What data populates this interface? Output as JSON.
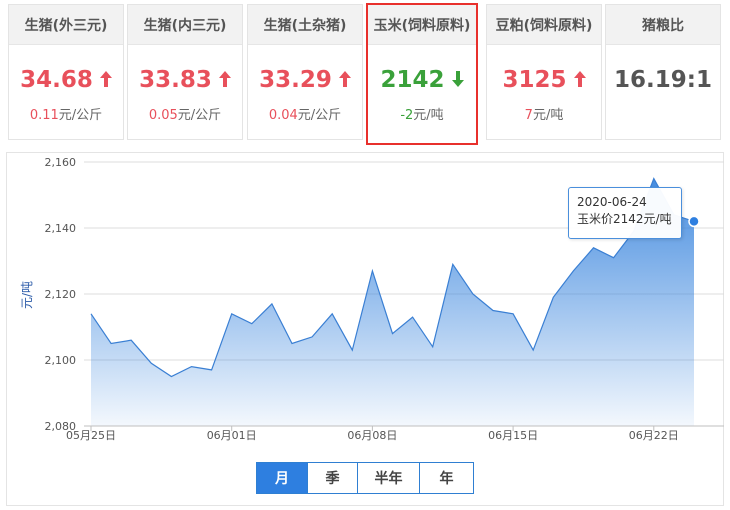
{
  "cards": [
    {
      "title": "生猪(外三元)",
      "value": "34.68",
      "direction": "up",
      "change_num": "0.11",
      "change_unit": "元/公斤"
    },
    {
      "title": "生猪(内三元)",
      "value": "33.83",
      "direction": "up",
      "change_num": "0.05",
      "change_unit": "元/公斤"
    },
    {
      "title": "生猪(土杂猪)",
      "value": "33.29",
      "direction": "up",
      "change_num": "0.04",
      "change_unit": "元/公斤"
    },
    {
      "title": "玉米(饲料原料)",
      "value": "2142",
      "direction": "down",
      "change_num": "-2",
      "change_unit": "元/吨",
      "selected": true
    },
    {
      "title": "豆粕(饲料原料)",
      "value": "3125",
      "direction": "up",
      "change_num": "7",
      "change_unit": "元/吨"
    },
    {
      "title": "猪粮比",
      "value": "16.19:1",
      "direction": "none",
      "change_num": "",
      "change_unit": ""
    }
  ],
  "colors": {
    "up": "#e8505b",
    "down": "#3aa13a",
    "accent": "#2e7fe0",
    "selected_border": "#e8302c"
  },
  "icons": {
    "up": "arrow-up-icon",
    "down": "arrow-down-icon"
  },
  "chart_data": {
    "type": "area",
    "title": "",
    "xlabel": "",
    "ylabel": "元/吨",
    "ylim": [
      2080,
      2160
    ],
    "yticks": [
      2080,
      2100,
      2120,
      2140,
      2160
    ],
    "ytick_labels": [
      "2,080",
      "2,100",
      "2,120",
      "2,140",
      "2,160"
    ],
    "x_start": "05月25日",
    "xtick_labels": [
      "05月25日",
      "06月01日",
      "06月08日",
      "06月15日",
      "06月22日"
    ],
    "xtick_days": [
      0,
      7,
      14,
      21,
      28
    ],
    "x_days": [
      0,
      1,
      2,
      3,
      4,
      5,
      6,
      7,
      8,
      9,
      10,
      11,
      12,
      13,
      14,
      15,
      16,
      17,
      18,
      19,
      20,
      21,
      22,
      23,
      24,
      25,
      26,
      27,
      28,
      29,
      30
    ],
    "values": [
      2114,
      2105,
      2106,
      2099,
      2095,
      2098,
      2097,
      2114,
      2111,
      2117,
      2105,
      2107,
      2114,
      2103,
      2127,
      2108,
      2113,
      2104,
      2129,
      2120,
      2115,
      2114,
      2103,
      2119,
      2127,
      2134,
      2131,
      2139,
      2155,
      2144,
      2142
    ],
    "grid": true,
    "legend": "none",
    "highlight_index": 30,
    "tooltip": {
      "date": "2020-06-24",
      "label": "玉米价2142元/吨"
    }
  },
  "period_tabs": [
    {
      "label": "月",
      "active": true
    },
    {
      "label": "季",
      "active": false
    },
    {
      "label": "半年",
      "active": false
    },
    {
      "label": "年",
      "active": false
    }
  ]
}
